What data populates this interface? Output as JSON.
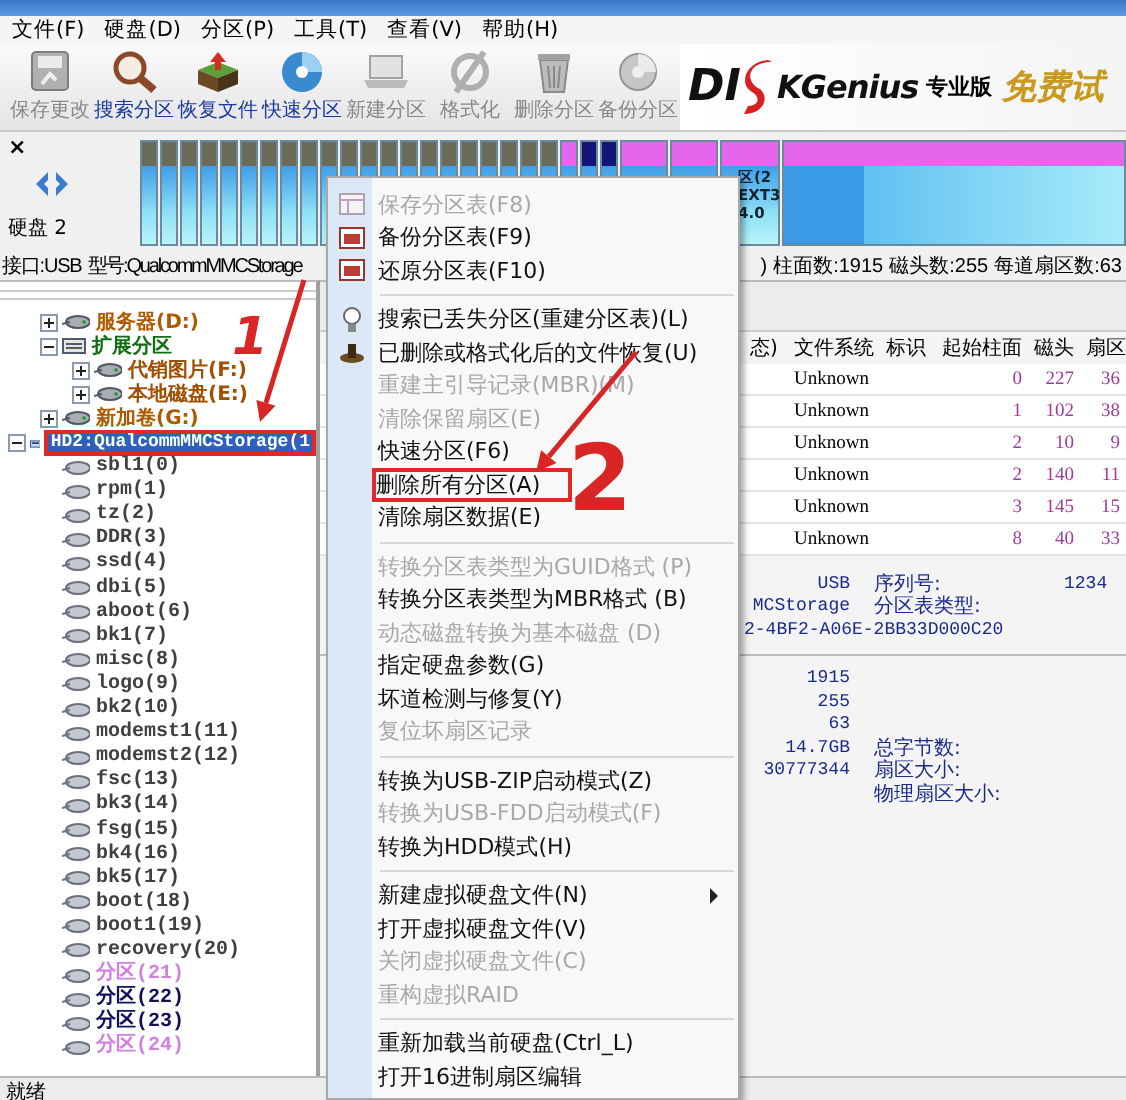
{
  "menu_bar": [
    {
      "label": "文件(F)"
    },
    {
      "label": "硬盘(D)"
    },
    {
      "label": "分区(P)"
    },
    {
      "label": "工具(T)"
    },
    {
      "label": "查看(V)"
    },
    {
      "label": "帮助(H)"
    }
  ],
  "toolbar": [
    {
      "label": "保存更改",
      "disabled": true
    },
    {
      "label": "搜索分区",
      "disabled": false
    },
    {
      "label": "恢复文件",
      "disabled": false
    },
    {
      "label": "快速分区",
      "disabled": false
    },
    {
      "label": "新建分区",
      "disabled": true
    },
    {
      "label": "格式化",
      "disabled": true
    },
    {
      "label": "删除分区",
      "disabled": true
    },
    {
      "label": "备份分区",
      "disabled": true
    }
  ],
  "logo": {
    "left": "DI",
    "right": "KGenius",
    "edition": "专业版",
    "slogan": "免费试"
  },
  "disk_map": {
    "close": "×",
    "label": "硬盘 2",
    "partitions": [
      {
        "color": "#6a6a58"
      },
      {
        "color": "#6a6a58"
      },
      {
        "color": "#6a6a58"
      },
      {
        "color": "#6a6a58"
      },
      {
        "color": "#6a6a58"
      },
      {
        "color": "#6a6a58"
      },
      {
        "color": "#6a6a58"
      },
      {
        "color": "#6a6a58"
      },
      {
        "color": "#6a6a58"
      },
      {
        "color": "#6a6a58"
      },
      {
        "color": "#6a6a58"
      },
      {
        "color": "#6a6a58"
      },
      {
        "color": "#6a6a58"
      },
      {
        "color": "#6a6a58"
      },
      {
        "color": "#6a6a58"
      },
      {
        "color": "#6a6a58"
      },
      {
        "color": "#6a6a58"
      },
      {
        "color": "#6a6a58"
      },
      {
        "color": "#6a6a58"
      },
      {
        "color": "#6a6a58"
      },
      {
        "color": "#6a6a58"
      },
      {
        "color": "#e466ec"
      },
      {
        "color": "#141478"
      },
      {
        "color": "#141478"
      },
      {
        "color": "#e466ec"
      },
      {
        "color": "#e466ec"
      },
      {
        "color": "#e466ec",
        "lines": [
          "区(2",
          "EXT3",
          "4.0"
        ]
      },
      {
        "color": "#e466ec"
      }
    ]
  },
  "info_line": {
    "left": [
      "接口:USB",
      "型号:QualcommMMCStorage"
    ],
    "right": [
      ")",
      "柱面数:1915",
      "磁头数:255",
      "每道扇区数:63"
    ]
  },
  "tree": {
    "items": [
      {
        "kind": "continuation",
        "children": [
          {
            "kind": "volume",
            "label": "服务器(D:)",
            "color": "#b05a00",
            "expanded": false
          },
          {
            "kind": "extended",
            "label": "扩展分区",
            "color": "#107010",
            "expanded": true,
            "children": [
              {
                "kind": "volume",
                "label": "代销图片(F:)",
                "color": "#a05000",
                "expanded": false
              },
              {
                "kind": "volume",
                "label": "本地磁盘(E:)",
                "color": "#a05000",
                "expanded": false
              }
            ]
          },
          {
            "kind": "volume",
            "label": "新加卷(G:)",
            "color": "#b05a00",
            "expanded": false
          }
        ]
      },
      {
        "kind": "disk",
        "label": "HD2:QualcommMMCStorage(1",
        "expanded": true,
        "selected": true,
        "boxed": true,
        "children": [
          {
            "kind": "partition",
            "label": "sbl1(0)",
            "color": "#404040"
          },
          {
            "kind": "partition",
            "label": "rpm(1)",
            "color": "#404040"
          },
          {
            "kind": "partition",
            "label": "tz(2)",
            "color": "#404040"
          },
          {
            "kind": "partition",
            "label": "DDR(3)",
            "color": "#404040"
          },
          {
            "kind": "partition",
            "label": "ssd(4)",
            "color": "#404040"
          },
          {
            "kind": "partition",
            "label": "dbi(5)",
            "color": "#404040"
          },
          {
            "kind": "partition",
            "label": "aboot(6)",
            "color": "#404040"
          },
          {
            "kind": "partition",
            "label": "bk1(7)",
            "color": "#404040"
          },
          {
            "kind": "partition",
            "label": "misc(8)",
            "color": "#404040"
          },
          {
            "kind": "partition",
            "label": "logo(9)",
            "color": "#404040"
          },
          {
            "kind": "partition",
            "label": "bk2(10)",
            "color": "#404040"
          },
          {
            "kind": "partition",
            "label": "modemst1(11)",
            "color": "#404040"
          },
          {
            "kind": "partition",
            "label": "modemst2(12)",
            "color": "#404040"
          },
          {
            "kind": "partition",
            "label": "fsc(13)",
            "color": "#404040"
          },
          {
            "kind": "partition",
            "label": "bk3(14)",
            "color": "#404040"
          },
          {
            "kind": "partition",
            "label": "fsg(15)",
            "color": "#404040"
          },
          {
            "kind": "partition",
            "label": "bk4(16)",
            "color": "#404040"
          },
          {
            "kind": "partition",
            "label": "bk5(17)",
            "color": "#404040"
          },
          {
            "kind": "partition",
            "label": "boot(18)",
            "color": "#404040"
          },
          {
            "kind": "partition",
            "label": "boot1(19)",
            "color": "#404040"
          },
          {
            "kind": "partition",
            "label": "recovery(20)",
            "color": "#404040"
          },
          {
            "kind": "partition",
            "label": "分区(21)",
            "color": "#d080e0"
          },
          {
            "kind": "partition",
            "label": "分区(22)",
            "color": "#101060"
          },
          {
            "kind": "partition",
            "label": "分区(23)",
            "color": "#101060"
          },
          {
            "kind": "partition",
            "label": "分区(24)",
            "color": "#d080e0"
          }
        ]
      }
    ]
  },
  "table": {
    "columns": [
      "态)",
      "文件系统",
      "标识",
      "起始柱面",
      "磁头",
      "扇区"
    ],
    "rows": [
      {
        "file_system": "Unknown",
        "start_cylinder": "0",
        "head": "227",
        "sector": "36"
      },
      {
        "file_system": "Unknown",
        "start_cylinder": "1",
        "head": "102",
        "sector": "38"
      },
      {
        "file_system": "Unknown",
        "start_cylinder": "2",
        "head": "10",
        "sector": "9"
      },
      {
        "file_system": "Unknown",
        "start_cylinder": "2",
        "head": "140",
        "sector": "11"
      },
      {
        "file_system": "Unknown",
        "start_cylinder": "3",
        "head": "145",
        "sector": "15"
      },
      {
        "file_system": "Unknown",
        "start_cylinder": "8",
        "head": "40",
        "sector": "33"
      }
    ]
  },
  "details": [
    [
      {
        "value": "USB",
        "label": "序列号:",
        "label_value": "1234"
      },
      {
        "value": "MCStorage",
        "label": "分区表类型:"
      },
      {
        "value": "2-4BF2-A06E-2BB33D000C20"
      }
    ],
    [
      {
        "value": "1915"
      },
      {
        "value": "255"
      },
      {
        "value": "63"
      },
      {
        "value": "14.7GB",
        "label": "总字节数:"
      },
      {
        "value": "30777344",
        "label": "扇区大小:"
      },
      {
        "label": "物理扇区大小:"
      }
    ]
  ],
  "context_menu": [
    {
      "kind": "item",
      "label": "保存分区表(F8)",
      "disabled": true,
      "submenu": false,
      "boxed": false
    },
    {
      "kind": "item",
      "label": "备份分区表(F9)",
      "disabled": false,
      "submenu": false,
      "boxed": false
    },
    {
      "kind": "item",
      "label": "还原分区表(F10)",
      "disabled": false,
      "submenu": false,
      "boxed": false
    },
    {
      "kind": "separator"
    },
    {
      "kind": "item",
      "label": "搜索已丢失分区(重建分区表)(L)",
      "disabled": false,
      "submenu": false,
      "boxed": false
    },
    {
      "kind": "item",
      "label": "已删除或格式化后的文件恢复(U)",
      "disabled": false,
      "submenu": false,
      "boxed": false
    },
    {
      "kind": "item",
      "label": "重建主引导记录(MBR)(M)",
      "disabled": true,
      "submenu": false,
      "boxed": false
    },
    {
      "kind": "item",
      "label": "清除保留扇区(E)",
      "disabled": true,
      "submenu": false,
      "boxed": false
    },
    {
      "kind": "item",
      "label": "快速分区(F6)",
      "disabled": false,
      "submenu": false,
      "boxed": false
    },
    {
      "kind": "item",
      "label": "删除所有分区(A)",
      "disabled": false,
      "submenu": false,
      "boxed": true
    },
    {
      "kind": "item",
      "label": "清除扇区数据(E)",
      "disabled": false,
      "submenu": false,
      "boxed": false
    },
    {
      "kind": "separator"
    },
    {
      "kind": "item",
      "label": "转换分区表类型为GUID格式 (P)",
      "disabled": true,
      "submenu": false,
      "boxed": false
    },
    {
      "kind": "item",
      "label": "转换分区表类型为MBR格式 (B)",
      "disabled": false,
      "submenu": false,
      "boxed": false
    },
    {
      "kind": "item",
      "label": "动态磁盘转换为基本磁盘 (D)",
      "disabled": true,
      "submenu": false,
      "boxed": false
    },
    {
      "kind": "item",
      "label": "指定硬盘参数(G)",
      "disabled": false,
      "submenu": false,
      "boxed": false
    },
    {
      "kind": "item",
      "label": "坏道检测与修复(Y)",
      "disabled": false,
      "submenu": false,
      "boxed": false
    },
    {
      "kind": "item",
      "label": "复位坏扇区记录",
      "disabled": true,
      "submenu": false,
      "boxed": false
    },
    {
      "kind": "separator"
    },
    {
      "kind": "item",
      "label": "转换为USB-ZIP启动模式(Z)",
      "disabled": false,
      "submenu": false,
      "boxed": false
    },
    {
      "kind": "item",
      "label": "转换为USB-FDD启动模式(F)",
      "disabled": true,
      "submenu": false,
      "boxed": false
    },
    {
      "kind": "item",
      "label": "转换为HDD模式(H)",
      "disabled": false,
      "submenu": false,
      "boxed": false
    },
    {
      "kind": "separator"
    },
    {
      "kind": "item",
      "label": "新建虚拟硬盘文件(N)",
      "disabled": false,
      "submenu": true,
      "boxed": false
    },
    {
      "kind": "item",
      "label": "打开虚拟硬盘文件(V)",
      "disabled": false,
      "submenu": false,
      "boxed": false
    },
    {
      "kind": "item",
      "label": "关闭虚拟硬盘文件(C)",
      "disabled": true,
      "submenu": false,
      "boxed": false
    },
    {
      "kind": "item",
      "label": "重构虚拟RAID",
      "disabled": true,
      "submenu": false,
      "boxed": false
    },
    {
      "kind": "separator"
    },
    {
      "kind": "item",
      "label": "重新加载当前硬盘(Ctrl_L)",
      "disabled": false,
      "submenu": false,
      "boxed": false
    },
    {
      "kind": "item",
      "label": "打开16进制扇区编辑",
      "disabled": false,
      "submenu": false,
      "boxed": false
    }
  ],
  "annotations": [
    {
      "kind": "number",
      "text": "1"
    },
    {
      "kind": "arrow"
    },
    {
      "kind": "number",
      "text": "2"
    },
    {
      "kind": "arrow"
    }
  ],
  "status_bar": {
    "text": "就绪"
  }
}
